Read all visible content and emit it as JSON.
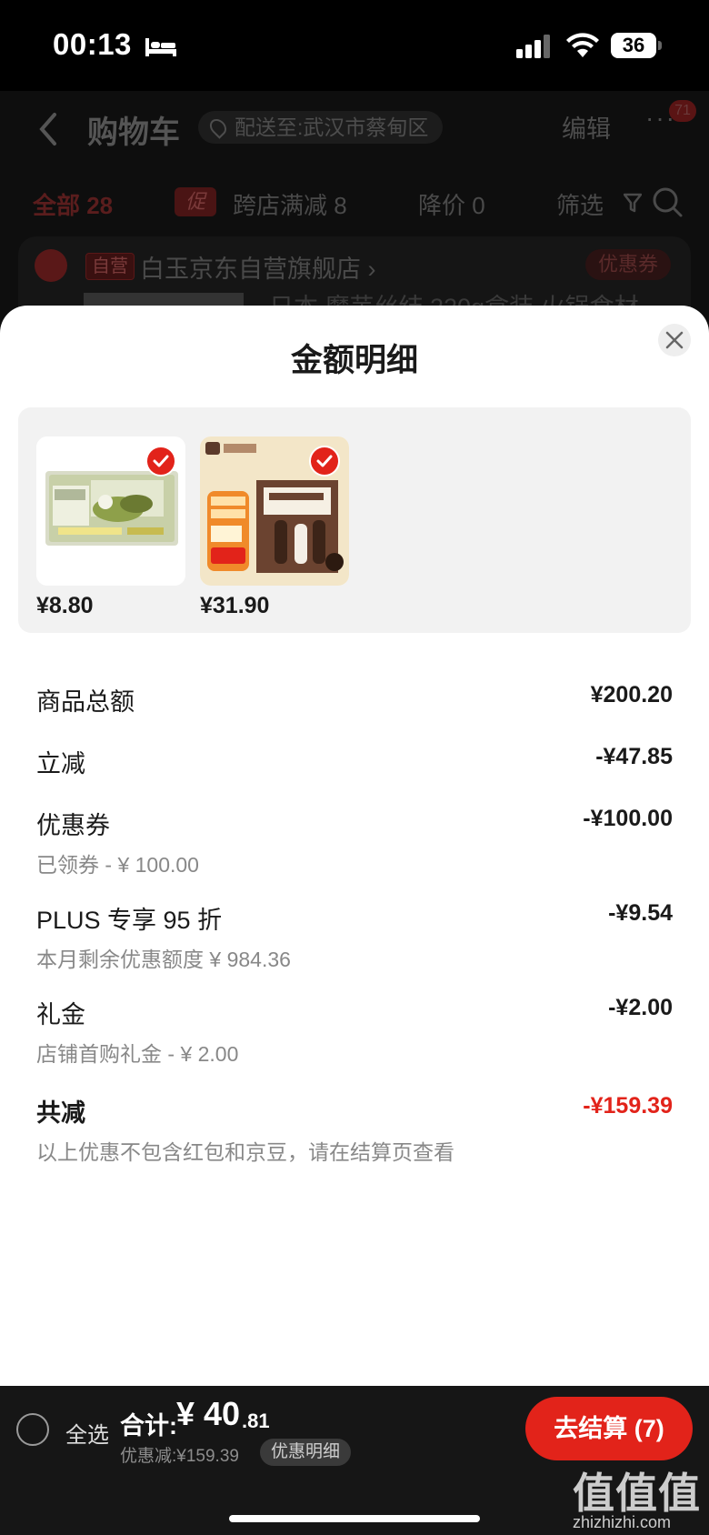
{
  "status": {
    "time": "00:13",
    "battery": "36"
  },
  "background": {
    "title": "购物车",
    "address": "配送至:武汉市蔡甸区",
    "edit": "编辑",
    "more": "···",
    "badge": "71",
    "tabs": [
      {
        "label": "全部 28"
      },
      {
        "label": "跨店满减 8"
      },
      {
        "label": "降价 0"
      }
    ],
    "promo_tag": "促",
    "filter": "筛选",
    "store_tag": "自营",
    "store_name": "白玉京东自营旗舰店 ›",
    "coupon": "优惠券",
    "product_name": "日本 魔芋丝结 220g盒装 火锅食材"
  },
  "sheet": {
    "title": "金额明细",
    "products": [
      {
        "price": "¥8.80"
      },
      {
        "price": "¥31.90"
      }
    ],
    "rows": [
      {
        "label": "商品总额",
        "value": "¥200.20"
      },
      {
        "label": "立减",
        "value": "-¥47.85"
      },
      {
        "label": "优惠券",
        "value": "-¥100.00",
        "sub": "已领券 - ¥ 100.00"
      },
      {
        "label": "PLUS 专享 95 折",
        "value": "-¥9.54",
        "sub": "本月剩余优惠额度 ¥ 984.36"
      },
      {
        "label": "礼金",
        "value": "-¥2.00",
        "sub": "店铺首购礼金 - ¥ 2.00"
      },
      {
        "label": "共减",
        "value": "-¥159.39",
        "sub": "以上优惠不包含红包和京豆，请在结算页查看"
      }
    ]
  },
  "bottom": {
    "select_all": "全选",
    "total_label": "合计:",
    "total_int": "¥ 40",
    "total_dec": ".81",
    "saved": "优惠减:¥159.39",
    "detail_button": "优惠明细",
    "checkout": "去结算 (7)",
    "watermark": "值值值",
    "watermark_url": "zhizhizhi.com"
  },
  "colors": {
    "accent": "#e2231a",
    "sheet_bg": "#ffffff",
    "panel_bg": "#f2f2f2"
  }
}
